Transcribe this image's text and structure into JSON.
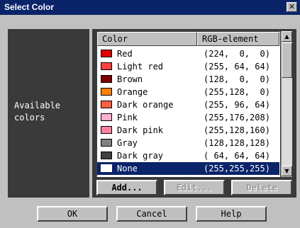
{
  "window": {
    "title": "Select Color",
    "close_glyph": "✕"
  },
  "left": {
    "label_line1": "Available",
    "label_line2": "colors"
  },
  "list": {
    "headers": {
      "color": "Color",
      "rgb": "RGB-element"
    },
    "rows": [
      {
        "name": "Red",
        "rgb": "(224,  0,  0)",
        "swatch": "#e00000"
      },
      {
        "name": "Light red",
        "rgb": "(255, 64, 64)",
        "swatch": "#ff4040"
      },
      {
        "name": "Brown",
        "rgb": "(128,  0,  0)",
        "swatch": "#800000"
      },
      {
        "name": "Orange",
        "rgb": "(255,128,  0)",
        "swatch": "#ff8000"
      },
      {
        "name": "Dark orange",
        "rgb": "(255, 96, 64)",
        "swatch": "#ff6040"
      },
      {
        "name": "Pink",
        "rgb": "(255,176,208)",
        "swatch": "#ffb0d0"
      },
      {
        "name": "Dark pink",
        "rgb": "(255,128,160)",
        "swatch": "#ff80a0"
      },
      {
        "name": "Gray",
        "rgb": "(128,128,128)",
        "swatch": "#808080"
      },
      {
        "name": "Dark gray",
        "rgb": "( 64, 64, 64)",
        "swatch": "#404040"
      },
      {
        "name": "None",
        "rgb": "(255,255,255)",
        "swatch": "#ffffff",
        "selected": true
      }
    ]
  },
  "scrollbar": {
    "up_icon": "▲",
    "down_icon": "▼"
  },
  "list_buttons": {
    "add": "Add...",
    "edit": "Edit...",
    "delete": "Delete"
  },
  "footer": {
    "ok": "OK",
    "cancel": "Cancel",
    "help": "Help"
  },
  "colors": {
    "titlebar": "#0a246a",
    "selection": "#0a246a",
    "panel": "#3a3a3a"
  }
}
